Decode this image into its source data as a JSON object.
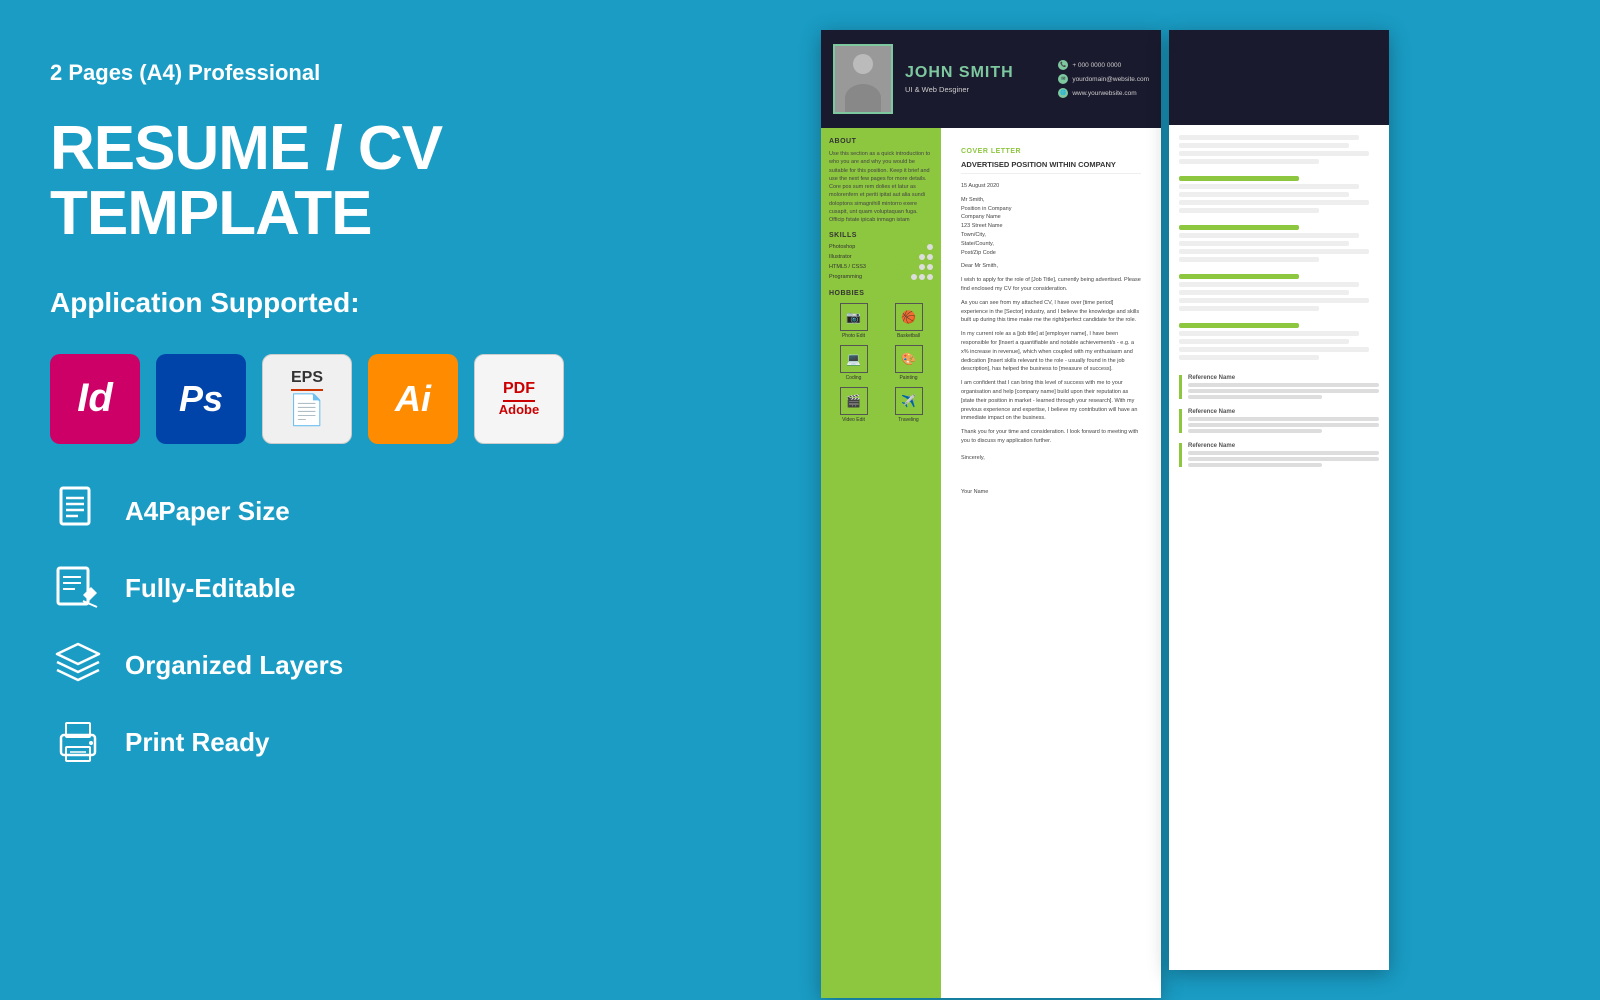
{
  "left": {
    "subtitle": "2 Pages (A4) Professional",
    "main_title": "RESUME / CV TEMPLATE",
    "app_supported_label": "Application Supported:",
    "apps": [
      {
        "id": "indesign",
        "label": "Id",
        "type": "indesign"
      },
      {
        "id": "photoshop",
        "label": "Ps",
        "type": "photoshop"
      },
      {
        "id": "eps",
        "label": "EPS",
        "type": "eps"
      },
      {
        "id": "illustrator",
        "label": "Ai",
        "type": "ai"
      },
      {
        "id": "pdf",
        "label": "PDF",
        "type": "pdf"
      }
    ],
    "features": [
      {
        "id": "a4paper",
        "label": "A4Paper Size",
        "icon": "document"
      },
      {
        "id": "editable",
        "label": "Fully-Editable",
        "icon": "edit"
      },
      {
        "id": "layers",
        "label": "Organized Layers",
        "icon": "layers"
      },
      {
        "id": "print",
        "label": "Print Ready",
        "icon": "printer"
      }
    ]
  },
  "resume": {
    "name": "JOHN SMITH",
    "job_title": "UI & Web Desginer",
    "phone": "+ 000 0000 0000",
    "email": "yourdomain@website.com",
    "website": "www.yourwebsite.com",
    "about_title": "ABOUT",
    "about_text": "Use this section as a quick introduction to who you are and why you would be suitable for this position. Keep it brief and use the next few pages for more details. Core pos sum rem dolies et latur as molorenfern et periti ipitat aut alia sundi doloptons simagnihill mintorro exere cusapit, unt quam voluptaquan fuga. Officip fstate ipicab inmagn istam",
    "skills_title": "SKILLS",
    "skills": [
      {
        "name": "Photoshop",
        "level": 4,
        "max": 5
      },
      {
        "name": "Illustrator",
        "level": 3,
        "max": 5
      },
      {
        "name": "HTML5 / CSS3",
        "level": 3,
        "max": 5
      },
      {
        "name": "Programming",
        "level": 2,
        "max": 5
      }
    ],
    "hobbies_title": "HOBBIES",
    "hobbies": [
      {
        "label": "Photo Edit",
        "icon": "📷"
      },
      {
        "label": "Basketball",
        "icon": "🏀"
      },
      {
        "label": "Coding",
        "icon": "💻"
      },
      {
        "label": "Painting",
        "icon": "🎨"
      },
      {
        "label": "Video Edit",
        "icon": "🎬"
      },
      {
        "label": "Traveling",
        "icon": "✈️"
      }
    ]
  },
  "cover_letter": {
    "section_title": "COVER LETTER",
    "position_title": "ADVERTISED POSITION WITHIN COMPANY",
    "date": "15 August 2020",
    "addressee": "Mr Smith,\nPosition in Company\nCompany Name\n123 Street Name\nTown/City,\nState/County,\nPost/Zip Code",
    "salutation": "Dear Mr Smith,",
    "body1": "I wish to apply for the role of [Job Title], currently being advertised. Please find enclosed my CV for your consideration.",
    "body2": "As you can see from my attached CV, I have over [time period] experience in the [Sector] industry, and I believe the knowledge and skills built up during this time make me the right/perfect candidate for the role.",
    "body3": "In my current role as a [job title] at [employer name], I have been responsible for [Insert a quantifiable and notable achievement/s - e.g. a x% increase in revenue], which when coupled with my enthusiasm and dedication [Insert skills relevant to the role - usually found in the job description], has helped the business to [measure of success].",
    "body4": "I am confident that I can bring this level of success with me to your organisation and help [company name] build upon their reputation as [state their position in market - learned through your research]. With my previous experience and expertise, I believe my contribution will have an immediate impact on the business.",
    "body5": "Thank you for your time and consideration. I look forward to meeting with you to discuss my application further.",
    "closing": "Sincerely,",
    "signature": "Your Name"
  },
  "colors": {
    "background": "#1a9cc4",
    "dark_header": "#1a1a2e",
    "green_accent": "#8dc63f",
    "name_color": "#7ec8a0",
    "white": "#ffffff"
  }
}
